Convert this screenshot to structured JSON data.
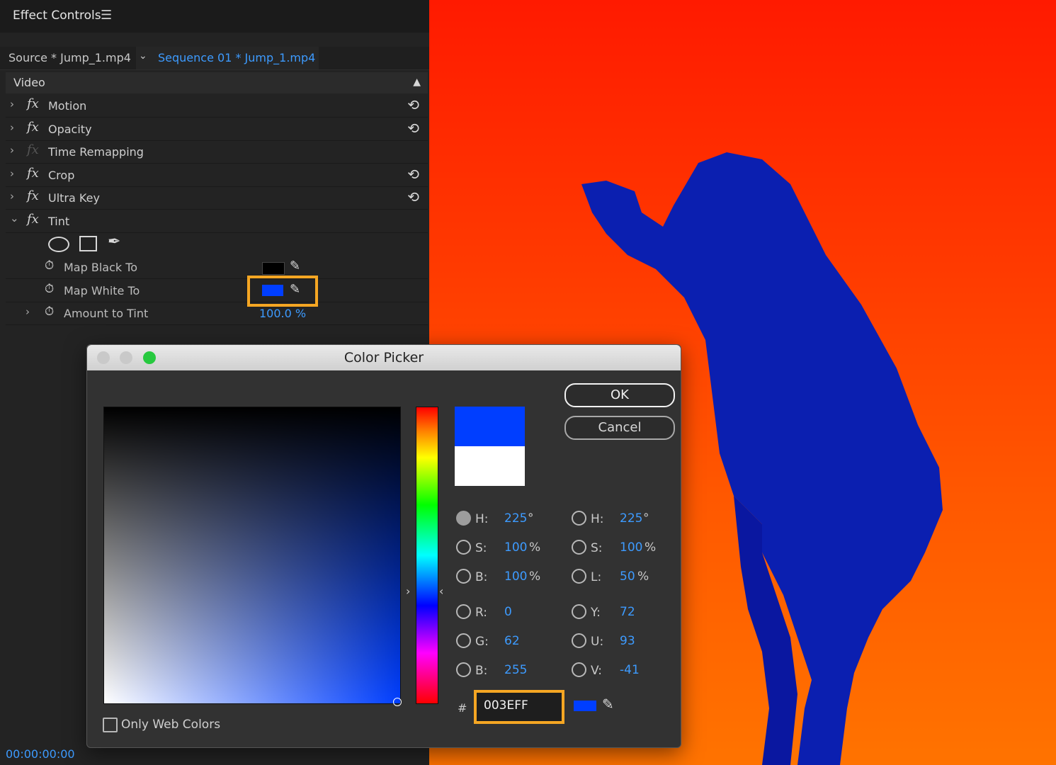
{
  "panel": {
    "title": "Effect Controls",
    "menu_icon": "☰",
    "source_tab": "Source * Jump_1.mp4",
    "sequence_tab": "Sequence 01 * Jump_1.mp4",
    "section": "Video",
    "effects": [
      {
        "label": "Motion",
        "fx": "fx"
      },
      {
        "label": "Opacity",
        "fx": "fx"
      },
      {
        "label": "Time Remapping",
        "fx": "fx"
      },
      {
        "label": "Crop",
        "fx": "fx"
      },
      {
        "label": "Ultra Key",
        "fx": "fx"
      },
      {
        "label": "Tint",
        "fx": "fx"
      }
    ],
    "tint": {
      "map_black_label": "Map Black To",
      "map_black_color": "#000000",
      "map_white_label": "Map White To",
      "map_white_color": "#003EFF",
      "amount_label": "Amount to Tint",
      "amount_value": "100.0 %"
    },
    "timecode": "00:00:00:00"
  },
  "color_picker": {
    "title": "Color Picker",
    "ok_label": "OK",
    "cancel_label": "Cancel",
    "new_color": "#003EFF",
    "old_color": "#FFFFFF",
    "hsb": {
      "h": {
        "key": "H:",
        "value": "225",
        "unit": "°"
      },
      "s": {
        "key": "S:",
        "value": "100",
        "unit": "%"
      },
      "b": {
        "key": "B:",
        "value": "100",
        "unit": "%"
      }
    },
    "rgb": {
      "r": {
        "key": "R:",
        "value": "0"
      },
      "g": {
        "key": "G:",
        "value": "62"
      },
      "b": {
        "key": "B:",
        "value": "255"
      }
    },
    "hsl": {
      "h": {
        "key": "H:",
        "value": "225",
        "unit": "°"
      },
      "s": {
        "key": "S:",
        "value": "100",
        "unit": "%"
      },
      "l": {
        "key": "L:",
        "value": "50",
        "unit": "%"
      }
    },
    "yuv": {
      "y": {
        "key": "Y:",
        "value": "72"
      },
      "u": {
        "key": "U:",
        "value": "93"
      },
      "v": {
        "key": "V:",
        "value": "-41"
      }
    },
    "hash": "#",
    "hex": "003EFF",
    "only_web_colors": "Only Web Colors",
    "accent_color": "#F5A623"
  }
}
